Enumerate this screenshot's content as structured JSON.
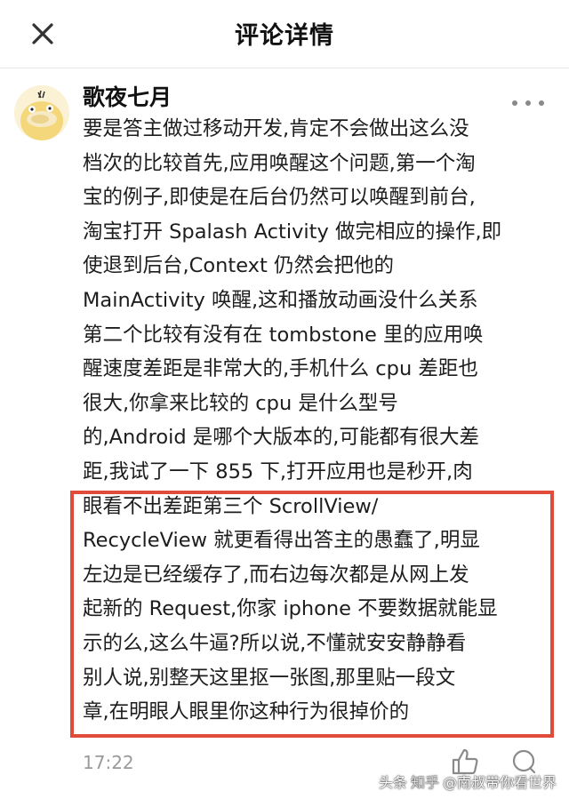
{
  "header": {
    "title": "评论详情",
    "close_icon": "close-icon"
  },
  "comment": {
    "author": "歌夜七月",
    "avatar_icon": "psyduck-avatar",
    "more_icon": "more-horizontal-icon",
    "lines": [
      "要是答主做过移动开发,肯定不会做出这么没",
      "档次的比较首先,应用唤醒这个问题,第一个淘",
      "宝的例子,即使是在后台仍然可以唤醒到前台,",
      "淘宝打开 Spalash Activity 做完相应的操作,即",
      "使退到后台,Context 仍然会把他的",
      "MainActivity 唤醒,这和播放动画没什么关系",
      "第二个比较有没有在 tombstone 里的应用唤",
      "醒速度差距是非常大的,手机什么 cpu 差距也",
      "很大,你拿来比较的 cpu 是什么型号",
      "的,Android 是哪个大版本的,可能都有很大差",
      "距,我试了一下 855 下,打开应用也是秒开,肉",
      "眼看不出差距第三个 ScrollView/",
      "RecycleView 就更看得出答主的愚蠢了,明显",
      "左边是已经缓存了,而右边每次都是从网上发",
      "起新的 Request,你家 iphone 不要数据就能显",
      "示的么,这么牛逼?所以说,不懂就安安静静看",
      "别人说,别整天这里抠一张图,那里贴一段文",
      "章,在明眼人眼里你这种行为很掉价的"
    ],
    "time": "17:22",
    "like_icon": "thumbs-up-icon",
    "reply_icon": "comment-bubble-icon",
    "highlight_color": "#e04b3a"
  },
  "watermark": {
    "platform": "头条",
    "faded": "知乎",
    "handle": "@南叔带你看世界"
  }
}
